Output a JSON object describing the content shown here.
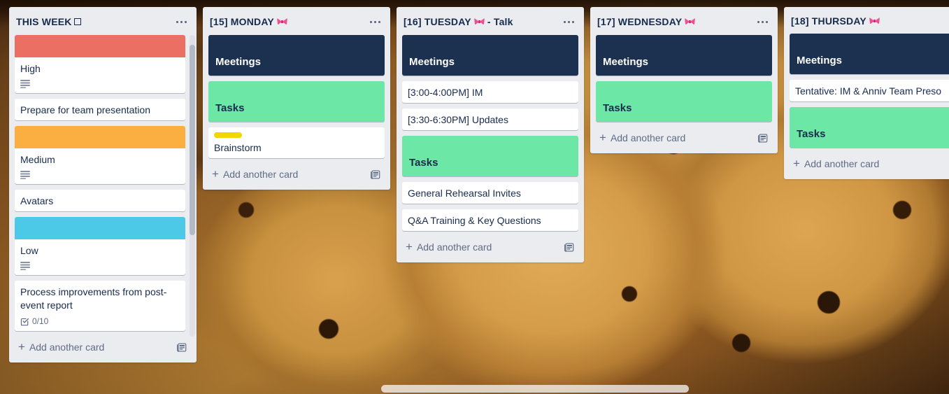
{
  "board": {
    "background_description": "chocolate-chip-cookies-photo",
    "colors": {
      "list_background": "#EBECF0",
      "card_background": "#FFFFFF",
      "text_primary": "#172B4D",
      "text_muted": "#5E6C84",
      "label_red": "#EB7063",
      "label_orange": "#FAAF40",
      "label_blue": "#4BC9E6",
      "label_yellow": "#F2D600",
      "header_navy": "#1C304F",
      "header_green": "#6CE7A6"
    }
  },
  "lists": [
    {
      "title": "THIS WEEK",
      "title_glyph": "box-glyph",
      "menu_label": "list-actions",
      "scrollable": true,
      "add_card": {
        "label": "Add another card",
        "plus": "+",
        "template_icon": "template-card-icon"
      },
      "cards": [
        {
          "type": "cover",
          "cover_color": "#EB7063",
          "title": "High",
          "badges": [
            {
              "icon": "description-icon"
            }
          ]
        },
        {
          "type": "plain",
          "title": "Prepare for team presentation",
          "badges": []
        },
        {
          "type": "cover",
          "cover_color": "#FAAF40",
          "title": "Medium",
          "badges": [
            {
              "icon": "description-icon"
            }
          ]
        },
        {
          "type": "plain",
          "title": "Avatars",
          "badges": []
        },
        {
          "type": "cover",
          "cover_color": "#4BC9E6",
          "title": "Low",
          "badges": [
            {
              "icon": "description-icon"
            }
          ]
        },
        {
          "type": "plain",
          "title": "Process improvements from post-event report",
          "badges": [
            {
              "icon": "checklist-icon",
              "text": "0/10"
            }
          ]
        }
      ]
    },
    {
      "title": "[15] MONDAY",
      "title_glyph": "bow-emoji",
      "menu_label": "list-actions",
      "scrollable": false,
      "add_card": {
        "label": "Add another card",
        "plus": "+",
        "template_icon": "template-card-icon"
      },
      "cards": [
        {
          "type": "section",
          "cover_color": "#1C304F",
          "title": "Meetings",
          "title_color": "#FFFFFF"
        },
        {
          "type": "section",
          "cover_color": "#6CE7A6",
          "title": "Tasks",
          "title_color": "#172B4D"
        },
        {
          "type": "labeled",
          "labels": [
            "#F2D600"
          ],
          "title": "Brainstorm"
        }
      ]
    },
    {
      "title": "[16] TUESDAY",
      "title_glyph": "bow-emoji",
      "title_suffix": "- Talk",
      "menu_label": "list-actions",
      "scrollable": false,
      "add_card": {
        "label": "Add another card",
        "plus": "+",
        "template_icon": "template-card-icon"
      },
      "cards": [
        {
          "type": "section",
          "cover_color": "#1C304F",
          "title": "Meetings",
          "title_color": "#FFFFFF"
        },
        {
          "type": "plain",
          "title": "[3:00-4:00PM] IM"
        },
        {
          "type": "plain",
          "title": "[3:30-6:30PM] Updates"
        },
        {
          "type": "section",
          "cover_color": "#6CE7A6",
          "title": "Tasks",
          "title_color": "#172B4D"
        },
        {
          "type": "plain",
          "title": "General Rehearsal Invites"
        },
        {
          "type": "plain",
          "title": "Q&A Training & Key Questions"
        }
      ]
    },
    {
      "title": "[17] WEDNESDAY",
      "title_glyph": "bow-emoji",
      "menu_label": "list-actions",
      "scrollable": false,
      "add_card": {
        "label": "Add another card",
        "plus": "+",
        "template_icon": "template-card-icon"
      },
      "cards": [
        {
          "type": "section",
          "cover_color": "#1C304F",
          "title": "Meetings",
          "title_color": "#FFFFFF"
        },
        {
          "type": "section",
          "cover_color": "#6CE7A6",
          "title": "Tasks",
          "title_color": "#172B4D"
        }
      ]
    },
    {
      "title": "[18] THURSDAY",
      "title_glyph": "bow-emoji",
      "menu_label": "list-actions",
      "scrollable": false,
      "add_card": {
        "label": "Add another card",
        "plus": "+",
        "template_icon": "template-card-icon"
      },
      "cards": [
        {
          "type": "section",
          "cover_color": "#1C304F",
          "title": "Meetings",
          "title_color": "#FFFFFF"
        },
        {
          "type": "plain",
          "title": "Tentative: IM & Anniv Team Preso"
        },
        {
          "type": "section",
          "cover_color": "#6CE7A6",
          "title": "Tasks",
          "title_color": "#172B4D"
        }
      ]
    }
  ]
}
